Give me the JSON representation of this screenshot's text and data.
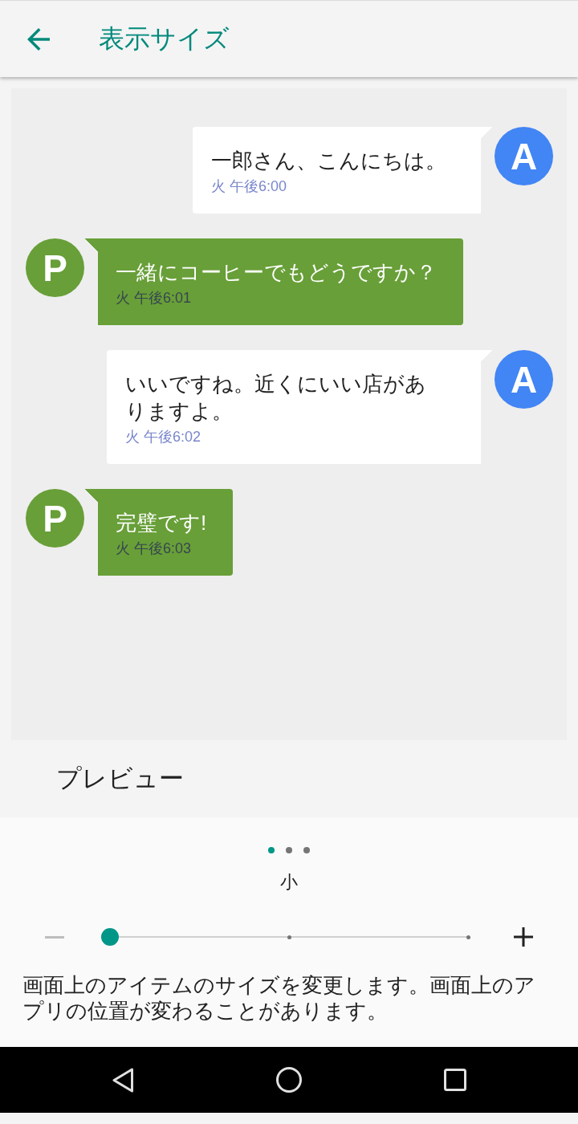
{
  "header": {
    "title": "表示サイズ"
  },
  "messages": [
    {
      "kind": "right",
      "text": "一郎さん、こんにちは。",
      "time": "火 午後6:00",
      "avatar": {
        "letter": "A",
        "color": "#4285f4"
      }
    },
    {
      "kind": "left",
      "text": "一緒にコーヒーでもどうですか？",
      "time": "火 午後6:01",
      "avatar": {
        "letter": "P",
        "color": "#689f38"
      }
    },
    {
      "kind": "right",
      "text": "いいですね。近くにいい店がありますよ。",
      "time": "火 午後6:02",
      "avatar": {
        "letter": "A",
        "color": "#4285f4"
      }
    },
    {
      "kind": "left",
      "text": "完璧です!",
      "time": "火 午後6:03",
      "avatar": {
        "letter": "P",
        "color": "#689f38"
      }
    }
  ],
  "preview_label": "プレビュー",
  "page_dots": [
    {
      "selected": true
    },
    {
      "selected": false
    },
    {
      "selected": false
    }
  ],
  "size_label": "小",
  "decrease_button": {
    "disabled": true
  },
  "increase_button": {
    "disabled": false
  },
  "slider": {
    "level": 0
  },
  "description": "画面上のアイテムのサイズを変更します。画面上のアプリの位置が変わることがあります。"
}
